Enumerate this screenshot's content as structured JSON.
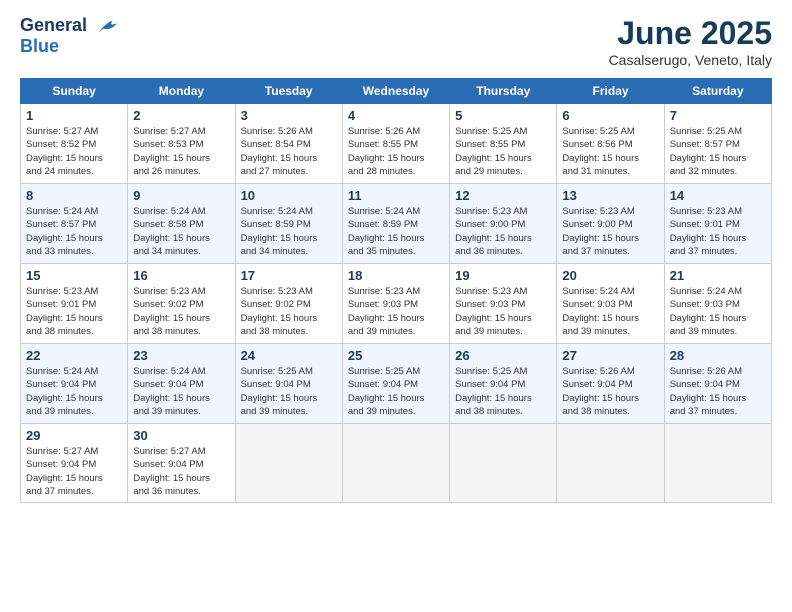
{
  "header": {
    "logo_line1": "General",
    "logo_line2": "Blue",
    "month": "June 2025",
    "location": "Casalserugo, Veneto, Italy"
  },
  "days_of_week": [
    "Sunday",
    "Monday",
    "Tuesday",
    "Wednesday",
    "Thursday",
    "Friday",
    "Saturday"
  ],
  "weeks": [
    [
      {
        "day": "1",
        "info": "Sunrise: 5:27 AM\nSunset: 8:52 PM\nDaylight: 15 hours\nand 24 minutes."
      },
      {
        "day": "2",
        "info": "Sunrise: 5:27 AM\nSunset: 8:53 PM\nDaylight: 15 hours\nand 26 minutes."
      },
      {
        "day": "3",
        "info": "Sunrise: 5:26 AM\nSunset: 8:54 PM\nDaylight: 15 hours\nand 27 minutes."
      },
      {
        "day": "4",
        "info": "Sunrise: 5:26 AM\nSunset: 8:55 PM\nDaylight: 15 hours\nand 28 minutes."
      },
      {
        "day": "5",
        "info": "Sunrise: 5:25 AM\nSunset: 8:55 PM\nDaylight: 15 hours\nand 29 minutes."
      },
      {
        "day": "6",
        "info": "Sunrise: 5:25 AM\nSunset: 8:56 PM\nDaylight: 15 hours\nand 31 minutes."
      },
      {
        "day": "7",
        "info": "Sunrise: 5:25 AM\nSunset: 8:57 PM\nDaylight: 15 hours\nand 32 minutes."
      }
    ],
    [
      {
        "day": "8",
        "info": "Sunrise: 5:24 AM\nSunset: 8:57 PM\nDaylight: 15 hours\nand 33 minutes."
      },
      {
        "day": "9",
        "info": "Sunrise: 5:24 AM\nSunset: 8:58 PM\nDaylight: 15 hours\nand 34 minutes."
      },
      {
        "day": "10",
        "info": "Sunrise: 5:24 AM\nSunset: 8:59 PM\nDaylight: 15 hours\nand 34 minutes."
      },
      {
        "day": "11",
        "info": "Sunrise: 5:24 AM\nSunset: 8:59 PM\nDaylight: 15 hours\nand 35 minutes."
      },
      {
        "day": "12",
        "info": "Sunrise: 5:23 AM\nSunset: 9:00 PM\nDaylight: 15 hours\nand 36 minutes."
      },
      {
        "day": "13",
        "info": "Sunrise: 5:23 AM\nSunset: 9:00 PM\nDaylight: 15 hours\nand 37 minutes."
      },
      {
        "day": "14",
        "info": "Sunrise: 5:23 AM\nSunset: 9:01 PM\nDaylight: 15 hours\nand 37 minutes."
      }
    ],
    [
      {
        "day": "15",
        "info": "Sunrise: 5:23 AM\nSunset: 9:01 PM\nDaylight: 15 hours\nand 38 minutes."
      },
      {
        "day": "16",
        "info": "Sunrise: 5:23 AM\nSunset: 9:02 PM\nDaylight: 15 hours\nand 38 minutes."
      },
      {
        "day": "17",
        "info": "Sunrise: 5:23 AM\nSunset: 9:02 PM\nDaylight: 15 hours\nand 38 minutes."
      },
      {
        "day": "18",
        "info": "Sunrise: 5:23 AM\nSunset: 9:03 PM\nDaylight: 15 hours\nand 39 minutes."
      },
      {
        "day": "19",
        "info": "Sunrise: 5:23 AM\nSunset: 9:03 PM\nDaylight: 15 hours\nand 39 minutes."
      },
      {
        "day": "20",
        "info": "Sunrise: 5:24 AM\nSunset: 9:03 PM\nDaylight: 15 hours\nand 39 minutes."
      },
      {
        "day": "21",
        "info": "Sunrise: 5:24 AM\nSunset: 9:03 PM\nDaylight: 15 hours\nand 39 minutes."
      }
    ],
    [
      {
        "day": "22",
        "info": "Sunrise: 5:24 AM\nSunset: 9:04 PM\nDaylight: 15 hours\nand 39 minutes."
      },
      {
        "day": "23",
        "info": "Sunrise: 5:24 AM\nSunset: 9:04 PM\nDaylight: 15 hours\nand 39 minutes."
      },
      {
        "day": "24",
        "info": "Sunrise: 5:25 AM\nSunset: 9:04 PM\nDaylight: 15 hours\nand 39 minutes."
      },
      {
        "day": "25",
        "info": "Sunrise: 5:25 AM\nSunset: 9:04 PM\nDaylight: 15 hours\nand 39 minutes."
      },
      {
        "day": "26",
        "info": "Sunrise: 5:25 AM\nSunset: 9:04 PM\nDaylight: 15 hours\nand 38 minutes."
      },
      {
        "day": "27",
        "info": "Sunrise: 5:26 AM\nSunset: 9:04 PM\nDaylight: 15 hours\nand 38 minutes."
      },
      {
        "day": "28",
        "info": "Sunrise: 5:26 AM\nSunset: 9:04 PM\nDaylight: 15 hours\nand 37 minutes."
      }
    ],
    [
      {
        "day": "29",
        "info": "Sunrise: 5:27 AM\nSunset: 9:04 PM\nDaylight: 15 hours\nand 37 minutes."
      },
      {
        "day": "30",
        "info": "Sunrise: 5:27 AM\nSunset: 9:04 PM\nDaylight: 15 hours\nand 36 minutes."
      },
      {
        "day": "",
        "info": ""
      },
      {
        "day": "",
        "info": ""
      },
      {
        "day": "",
        "info": ""
      },
      {
        "day": "",
        "info": ""
      },
      {
        "day": "",
        "info": ""
      }
    ]
  ]
}
